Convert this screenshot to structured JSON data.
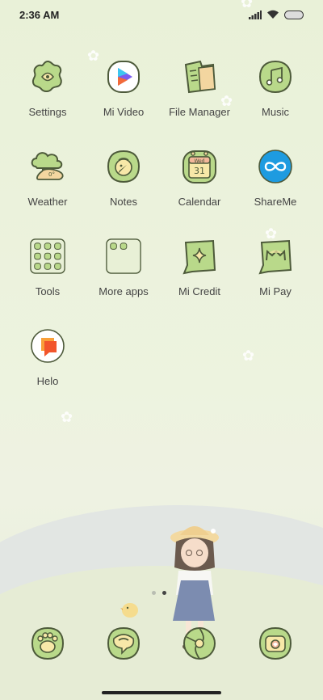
{
  "status_bar": {
    "time": "2:36 AM",
    "icons": [
      "signal-icon",
      "wifi-icon",
      "battery-icon"
    ]
  },
  "apps": [
    {
      "label": "Settings",
      "icon": "settings-icon"
    },
    {
      "label": "Mi Video",
      "icon": "mi-video-icon"
    },
    {
      "label": "File Manager",
      "icon": "file-manager-icon"
    },
    {
      "label": "Music",
      "icon": "music-icon"
    },
    {
      "label": "Weather",
      "icon": "weather-icon"
    },
    {
      "label": "Notes",
      "icon": "notes-icon"
    },
    {
      "label": "Calendar",
      "icon": "calendar-icon",
      "day_name": "Wed",
      "day_number": "31"
    },
    {
      "label": "ShareMe",
      "icon": "shareme-icon"
    },
    {
      "label": "Tools",
      "icon": "tools-folder-icon"
    },
    {
      "label": "More apps",
      "icon": "more-apps-folder-icon"
    },
    {
      "label": "Mi Credit",
      "icon": "mi-credit-icon"
    },
    {
      "label": "Mi Pay",
      "icon": "mi-pay-icon"
    },
    {
      "label": "Helo",
      "icon": "helo-icon"
    }
  ],
  "page_indicator": {
    "pages": 2,
    "current": 2
  },
  "dock": [
    {
      "icon": "phone-icon"
    },
    {
      "icon": "messages-icon"
    },
    {
      "icon": "browser-icon"
    },
    {
      "icon": "camera-icon"
    }
  ],
  "colors": {
    "icon_fill": "#b9d98a",
    "icon_outline": "#4d5a3a",
    "background": "#eaf1db",
    "shareme_blue": "#1e9be0",
    "helo_orange": "#f2552c"
  }
}
